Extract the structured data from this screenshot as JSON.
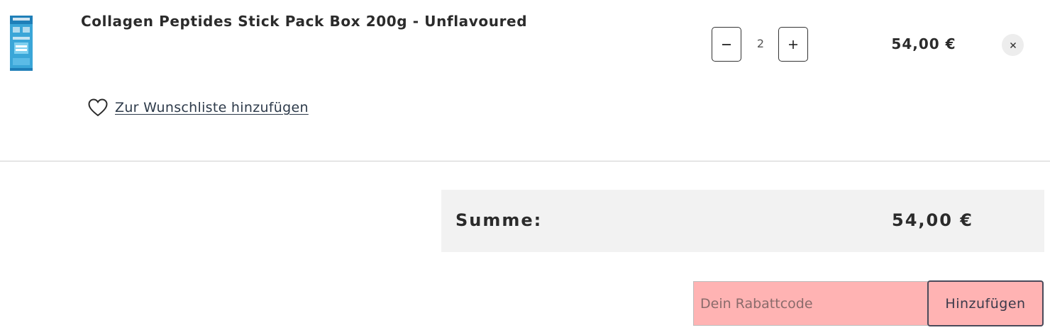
{
  "cart_item": {
    "name": "Collagen Peptides Stick Pack Box 200g - Unflavoured",
    "image_icon": "product-box-image",
    "quantity": "2",
    "price": "54,00 €",
    "wishlist_label": "Zur Wunschliste hinzufügen"
  },
  "summary": {
    "total_label": "Summe:",
    "total_value": "54,00 €"
  },
  "discount": {
    "placeholder": "Dein Rabattcode",
    "button_label": "Hinzufügen"
  },
  "colors": {
    "accent_highlight": "#ffb3b3",
    "summary_bg": "#f2f2f2",
    "text_dark": "#2b2b2b"
  }
}
